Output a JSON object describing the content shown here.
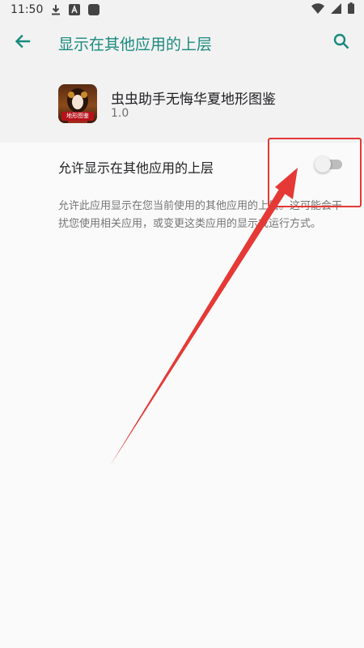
{
  "status_bar": {
    "time": "11:50",
    "icons": [
      "download-icon",
      "a-icon",
      "notification-square-icon",
      "wifi-icon",
      "signal-icon",
      "battery-icon"
    ]
  },
  "app_bar": {
    "title": "显示在其他应用的上层",
    "back_icon": "arrow-left-icon",
    "search_icon": "search-icon"
  },
  "app": {
    "name": "虫虫助手无悔华夏地形图鉴",
    "version": "1.0",
    "icon_label": "地形图鉴"
  },
  "setting": {
    "label": "允许显示在其他应用的上层",
    "enabled": false
  },
  "description": "允许此应用显示在您当前使用的其他应用的上层。这可能会干扰您使用相关应用，或变更这类应用的显示或运行方式。",
  "colors": {
    "accent": "#1a8a7e",
    "annotation": "#e53935",
    "background": "#fafafa",
    "header_background": "#f2f2f2"
  }
}
